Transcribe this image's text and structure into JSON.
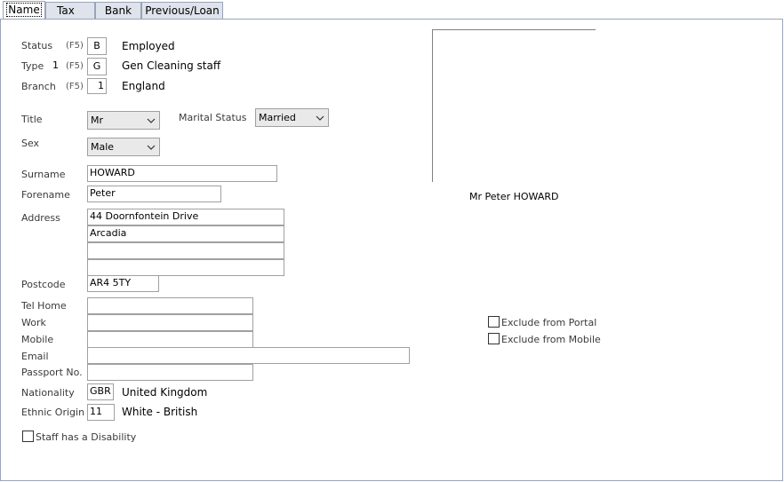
{
  "tabs": [
    {
      "label": "Name",
      "active": true
    },
    {
      "label": "Tax",
      "active": false
    },
    {
      "label": "Bank",
      "active": false
    },
    {
      "label": "Previous/Loan",
      "active": false
    }
  ],
  "status": {
    "label": "Status",
    "key": "(F5)",
    "code": "B",
    "desc": "Employed"
  },
  "type": {
    "label": "Type",
    "num": "1",
    "key": "(F5)",
    "code": "G",
    "desc": "Gen Cleaning staff"
  },
  "branch": {
    "label": "Branch",
    "key": "(F5)",
    "code": "1",
    "desc": "England"
  },
  "title": {
    "label": "Title",
    "value": "Mr"
  },
  "marital": {
    "label": "Marital Status",
    "value": "Married"
  },
  "sex": {
    "label": "Sex",
    "value": "Male"
  },
  "surname": {
    "label": "Surname",
    "value": "HOWARD"
  },
  "forename": {
    "label": "Forename",
    "value": "Peter"
  },
  "address": {
    "label": "Address",
    "lines": [
      "44 Doornfontein Drive",
      "Arcadia",
      "",
      ""
    ]
  },
  "postcode": {
    "label": "Postcode",
    "value": "AR4 5TY"
  },
  "tel_home": {
    "label": "Tel Home",
    "value": ""
  },
  "work": {
    "label": "Work",
    "value": ""
  },
  "mobile": {
    "label": "Mobile",
    "value": ""
  },
  "email": {
    "label": "Email",
    "value": ""
  },
  "passport": {
    "label": "Passport No.",
    "value": ""
  },
  "nationality": {
    "label": "Nationality",
    "code": "GBR",
    "desc": "United Kingdom"
  },
  "ethnic": {
    "label": "Ethnic Origin",
    "code": "11",
    "desc": "White - British"
  },
  "disability": {
    "label": "Staff has a Disability",
    "checked": false
  },
  "display_name": "Mr Peter HOWARD",
  "exclude_portal": {
    "label": "Exclude from Portal",
    "checked": false
  },
  "exclude_mobile": {
    "label": "Exclude from Mobile",
    "checked": false
  }
}
